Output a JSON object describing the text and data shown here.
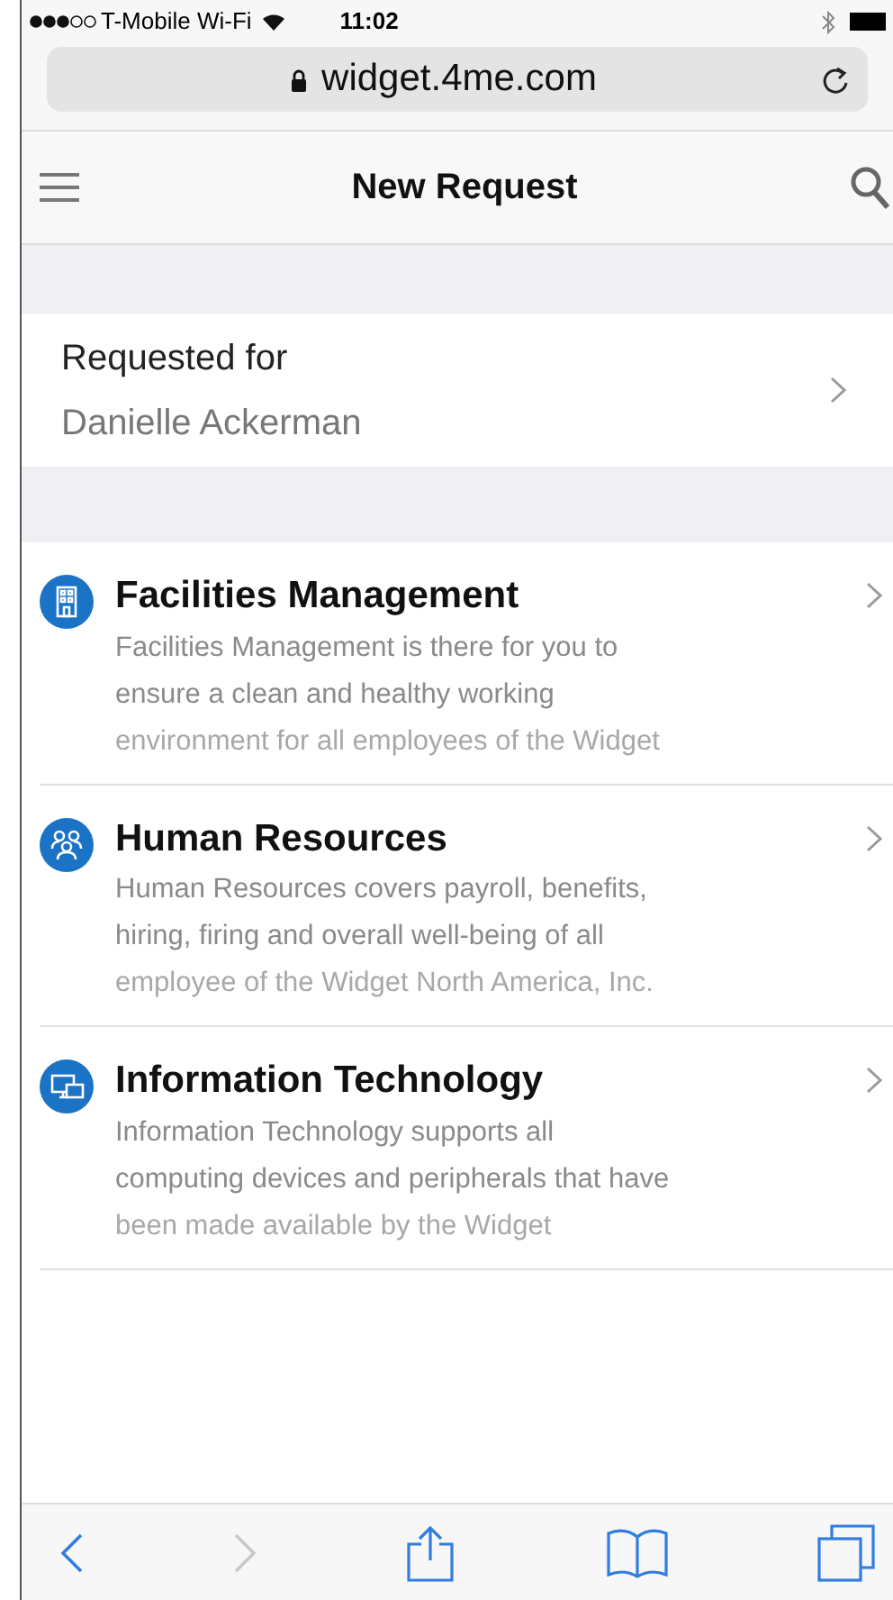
{
  "status_bar": {
    "carrier": "T-Mobile Wi-Fi",
    "time": "11:02"
  },
  "address_bar": {
    "url": "widget.4me.com"
  },
  "header": {
    "title": "New Request"
  },
  "requested_for": {
    "label": "Requested for",
    "value": "Danielle Ackerman"
  },
  "services": [
    {
      "kind": "building",
      "title": "Facilities Management",
      "lines": [
        "Facilities Management is there for you to",
        "ensure a clean and healthy working",
        "environment for all employees of the Widget"
      ]
    },
    {
      "kind": "people",
      "title": "Human Resources",
      "lines": [
        "Human Resources covers payroll, benefits,",
        "hiring, firing and overall well-being of all",
        "employee of the Widget North America, Inc."
      ]
    },
    {
      "kind": "devices",
      "title": "Information Technology",
      "lines": [
        "Information Technology supports all",
        "computing devices and peripherals that have",
        "been made available by the Widget"
      ]
    }
  ],
  "toolbar": {
    "back_disabled": false,
    "forward_disabled": true
  }
}
